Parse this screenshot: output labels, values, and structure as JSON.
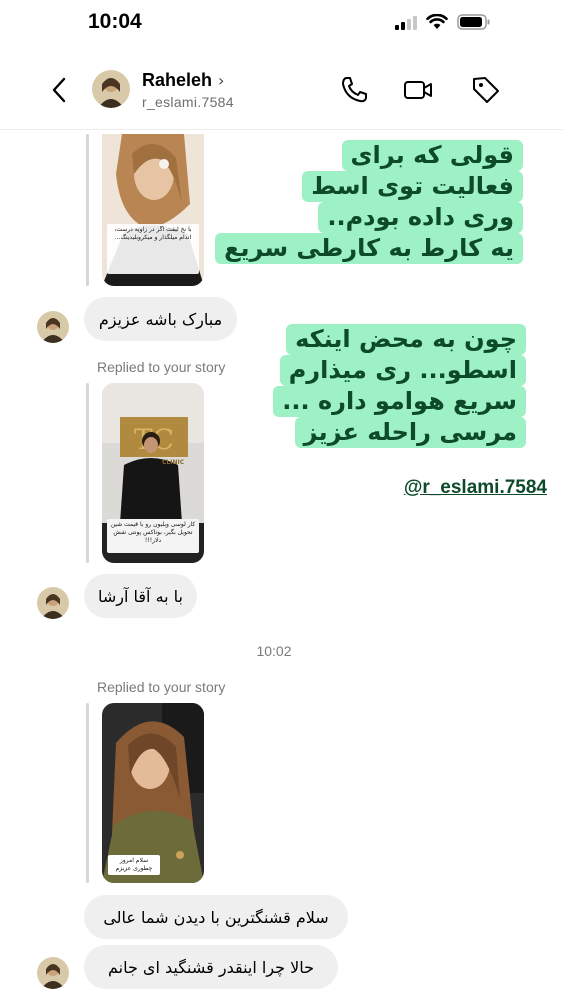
{
  "status_bar": {
    "time": "10:04"
  },
  "header": {
    "name": "Raheleh",
    "chevron": "›",
    "handle": "r_eslami.7584",
    "icons": [
      "back-chevron-icon",
      "phone-icon",
      "video-camera-icon",
      "tag-icon"
    ]
  },
  "captions": {
    "block1": [
      "قولی که برای",
      "فعالیت توی اسط",
      "وری داده بودم..",
      "یه کارط به کارطی سریع"
    ],
    "block2": [
      "چون به محض اینکه",
      "اسطو... ری میذارم",
      "سریع هوامو داره ...",
      "مرسی راحله عزیز"
    ],
    "mention": "@r_eslami.7584"
  },
  "messages": {
    "msg1": "مبارک باشه عزیزم",
    "replied_label_1": "Replied to your story",
    "msg2": "با به آقا آرشا",
    "timestamp": "10:02",
    "replied_label_2": "Replied to your story",
    "msg3": "سلام قشنگترین با دیدن شما عالی",
    "msg4": "حالا چرا اینقدر قشنگید ای جانم"
  },
  "stories": {
    "story1_text": "با نخ لیفت اگر در زاویه درست، اندام میلگذار و میکروبلیدینگ...",
    "story2_logo": "CLINIC",
    "story2_text": "کار لوسی ویلیون رو با قیمت شین تحویل بگیر، بوتاکس پونتی شش دلار!!!",
    "story3_text": "سلام امروز چطوری عزیزم"
  },
  "colors": {
    "caption_bg": "#9ef0c5",
    "caption_text": "#0d4a2a",
    "bubble_bg": "#efeff0"
  }
}
